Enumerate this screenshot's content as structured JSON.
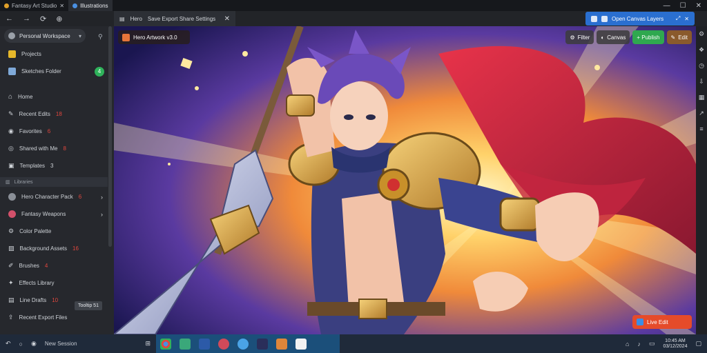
{
  "tabs": [
    {
      "label": "Fantasy Art Studio",
      "color": "#e0a02a"
    },
    {
      "label": "Illustrations",
      "color": "#4a90e2"
    }
  ],
  "toolbar": {
    "page_tab": "Hero",
    "page_tab_subtitle": "Save  Export  Share  Settings",
    "top_chip": "Open Canvas Layers"
  },
  "sidebar": {
    "profile_name": "Personal Workspace",
    "items_top": [
      {
        "label": "Projects",
        "icon_color": "#e6b82a"
      },
      {
        "label": "Sketches Folder",
        "icon_color": "#7fa9d8",
        "badge_pill": "4"
      }
    ],
    "items_mid": [
      {
        "label": "Home",
        "icon": "⌂"
      },
      {
        "label": "Recent Edits",
        "badge": "18"
      },
      {
        "label": "Favorites",
        "badge": "6"
      },
      {
        "label": "Shared with Me",
        "badge": "8"
      },
      {
        "label": "Templates",
        "badge": "3"
      }
    ],
    "section_label": "Libraries",
    "items_bottom": [
      {
        "label": "Hero Character Pack",
        "badge": "6",
        "arrow": "›"
      },
      {
        "label": "Fantasy Weapons",
        "arrow": "›"
      },
      {
        "label": "Color Palette"
      },
      {
        "label": "Background Assets",
        "badge": "16"
      },
      {
        "label": "Brushes",
        "badge": "4"
      },
      {
        "label": "Effects Library"
      },
      {
        "label": "Line Drafts",
        "badge": "10"
      },
      {
        "label": "Recent Export Files"
      }
    ],
    "tooltip": "Tooltip 51"
  },
  "stage": {
    "title_chip": "Hero Artwork v3.0",
    "chips_right": [
      "Filter",
      "Canvas",
      "+  Publish",
      "Edit"
    ],
    "bottom_chip": "Live  Edit"
  },
  "taskbar": {
    "label": "New Session",
    "clock_time": "10:45 AM",
    "clock_date": "03/12/2024"
  }
}
